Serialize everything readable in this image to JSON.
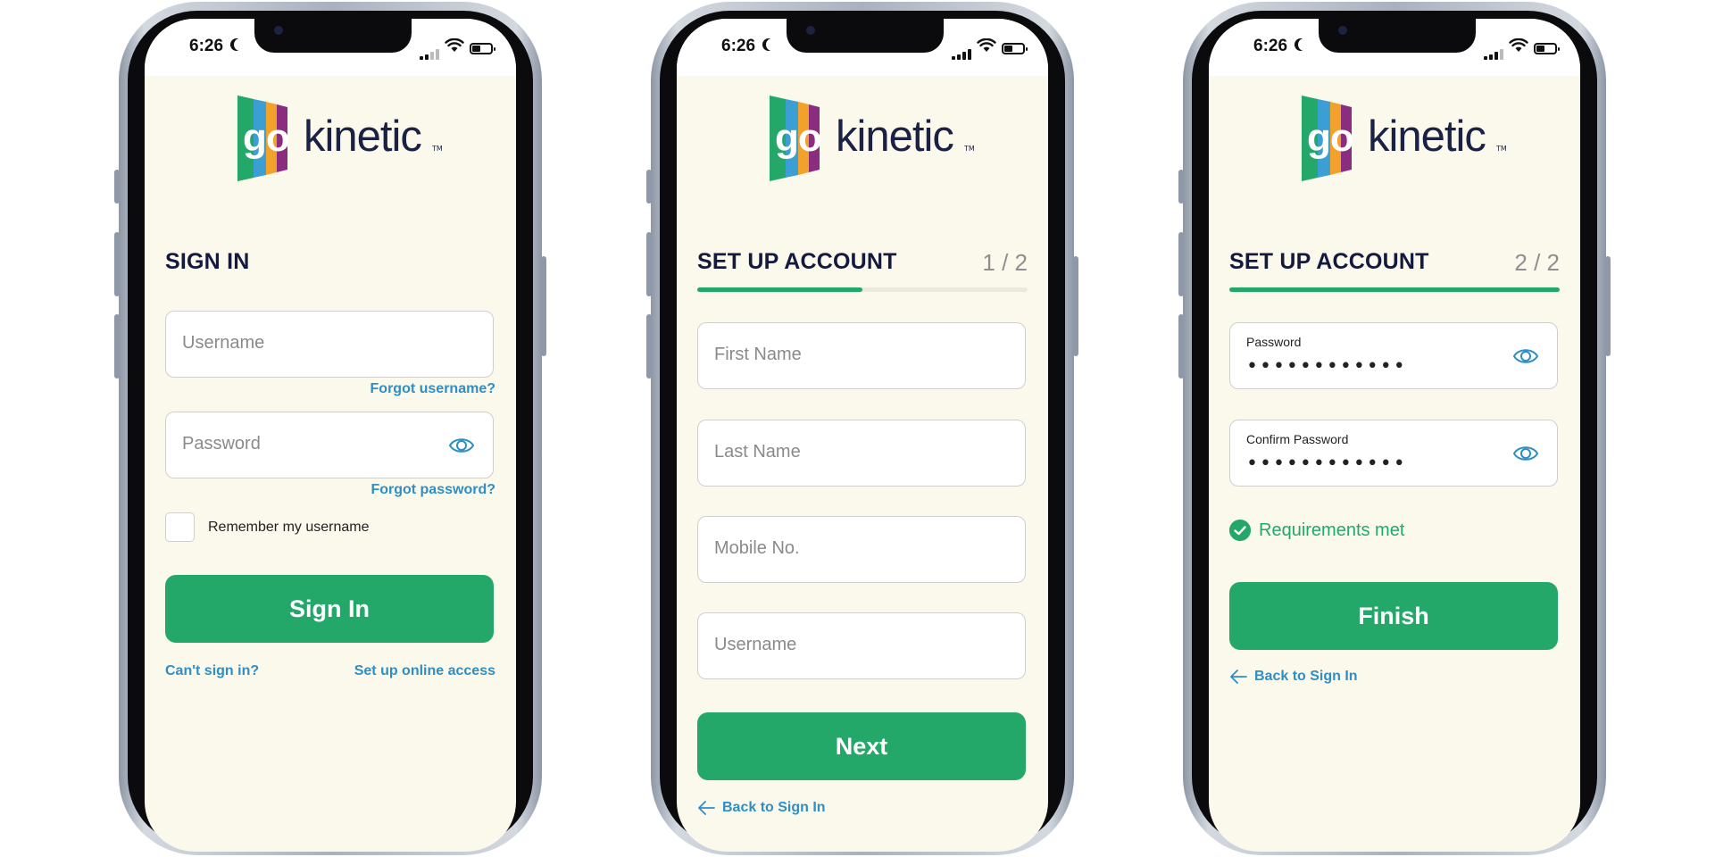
{
  "status_bar": {
    "time": "6:26"
  },
  "logo": {
    "go": "go",
    "kinetic": "kinetic",
    "tm": "TM",
    "stripe_colors": [
      "#24a86a",
      "#3c9fd4",
      "#f2a12b",
      "#8b2d7f"
    ]
  },
  "colors": {
    "brand_green": "#24a86a",
    "link_blue": "#2f8fc4",
    "heading_navy": "#141a3d",
    "screen_bg": "#fbf8ec"
  },
  "sign_in": {
    "heading": "SIGN IN",
    "username_placeholder": "Username",
    "forgot_username": "Forgot username?",
    "password_placeholder": "Password",
    "forgot_password": "Forgot password?",
    "remember_label": "Remember my username",
    "sign_in_button": "Sign In",
    "cant_sign_in": "Can't sign in?",
    "setup_access": "Set up online access"
  },
  "setup_step1": {
    "heading": "SET UP ACCOUNT",
    "step": "1 / 2",
    "progress": 0.5,
    "first_name_placeholder": "First Name",
    "last_name_placeholder": "Last Name",
    "mobile_placeholder": "Mobile No.",
    "username_placeholder": "Username",
    "next_button": "Next",
    "back_link": "Back to Sign In"
  },
  "setup_step2": {
    "heading": "SET UP ACCOUNT",
    "step": "2 / 2",
    "progress": 1.0,
    "password_label": "Password",
    "password_mask": "••••••••••••",
    "confirm_label": "Confirm Password",
    "confirm_mask": "••••••••••••",
    "requirements": "Requirements met",
    "finish_button": "Finish",
    "back_link": "Back to Sign In"
  }
}
